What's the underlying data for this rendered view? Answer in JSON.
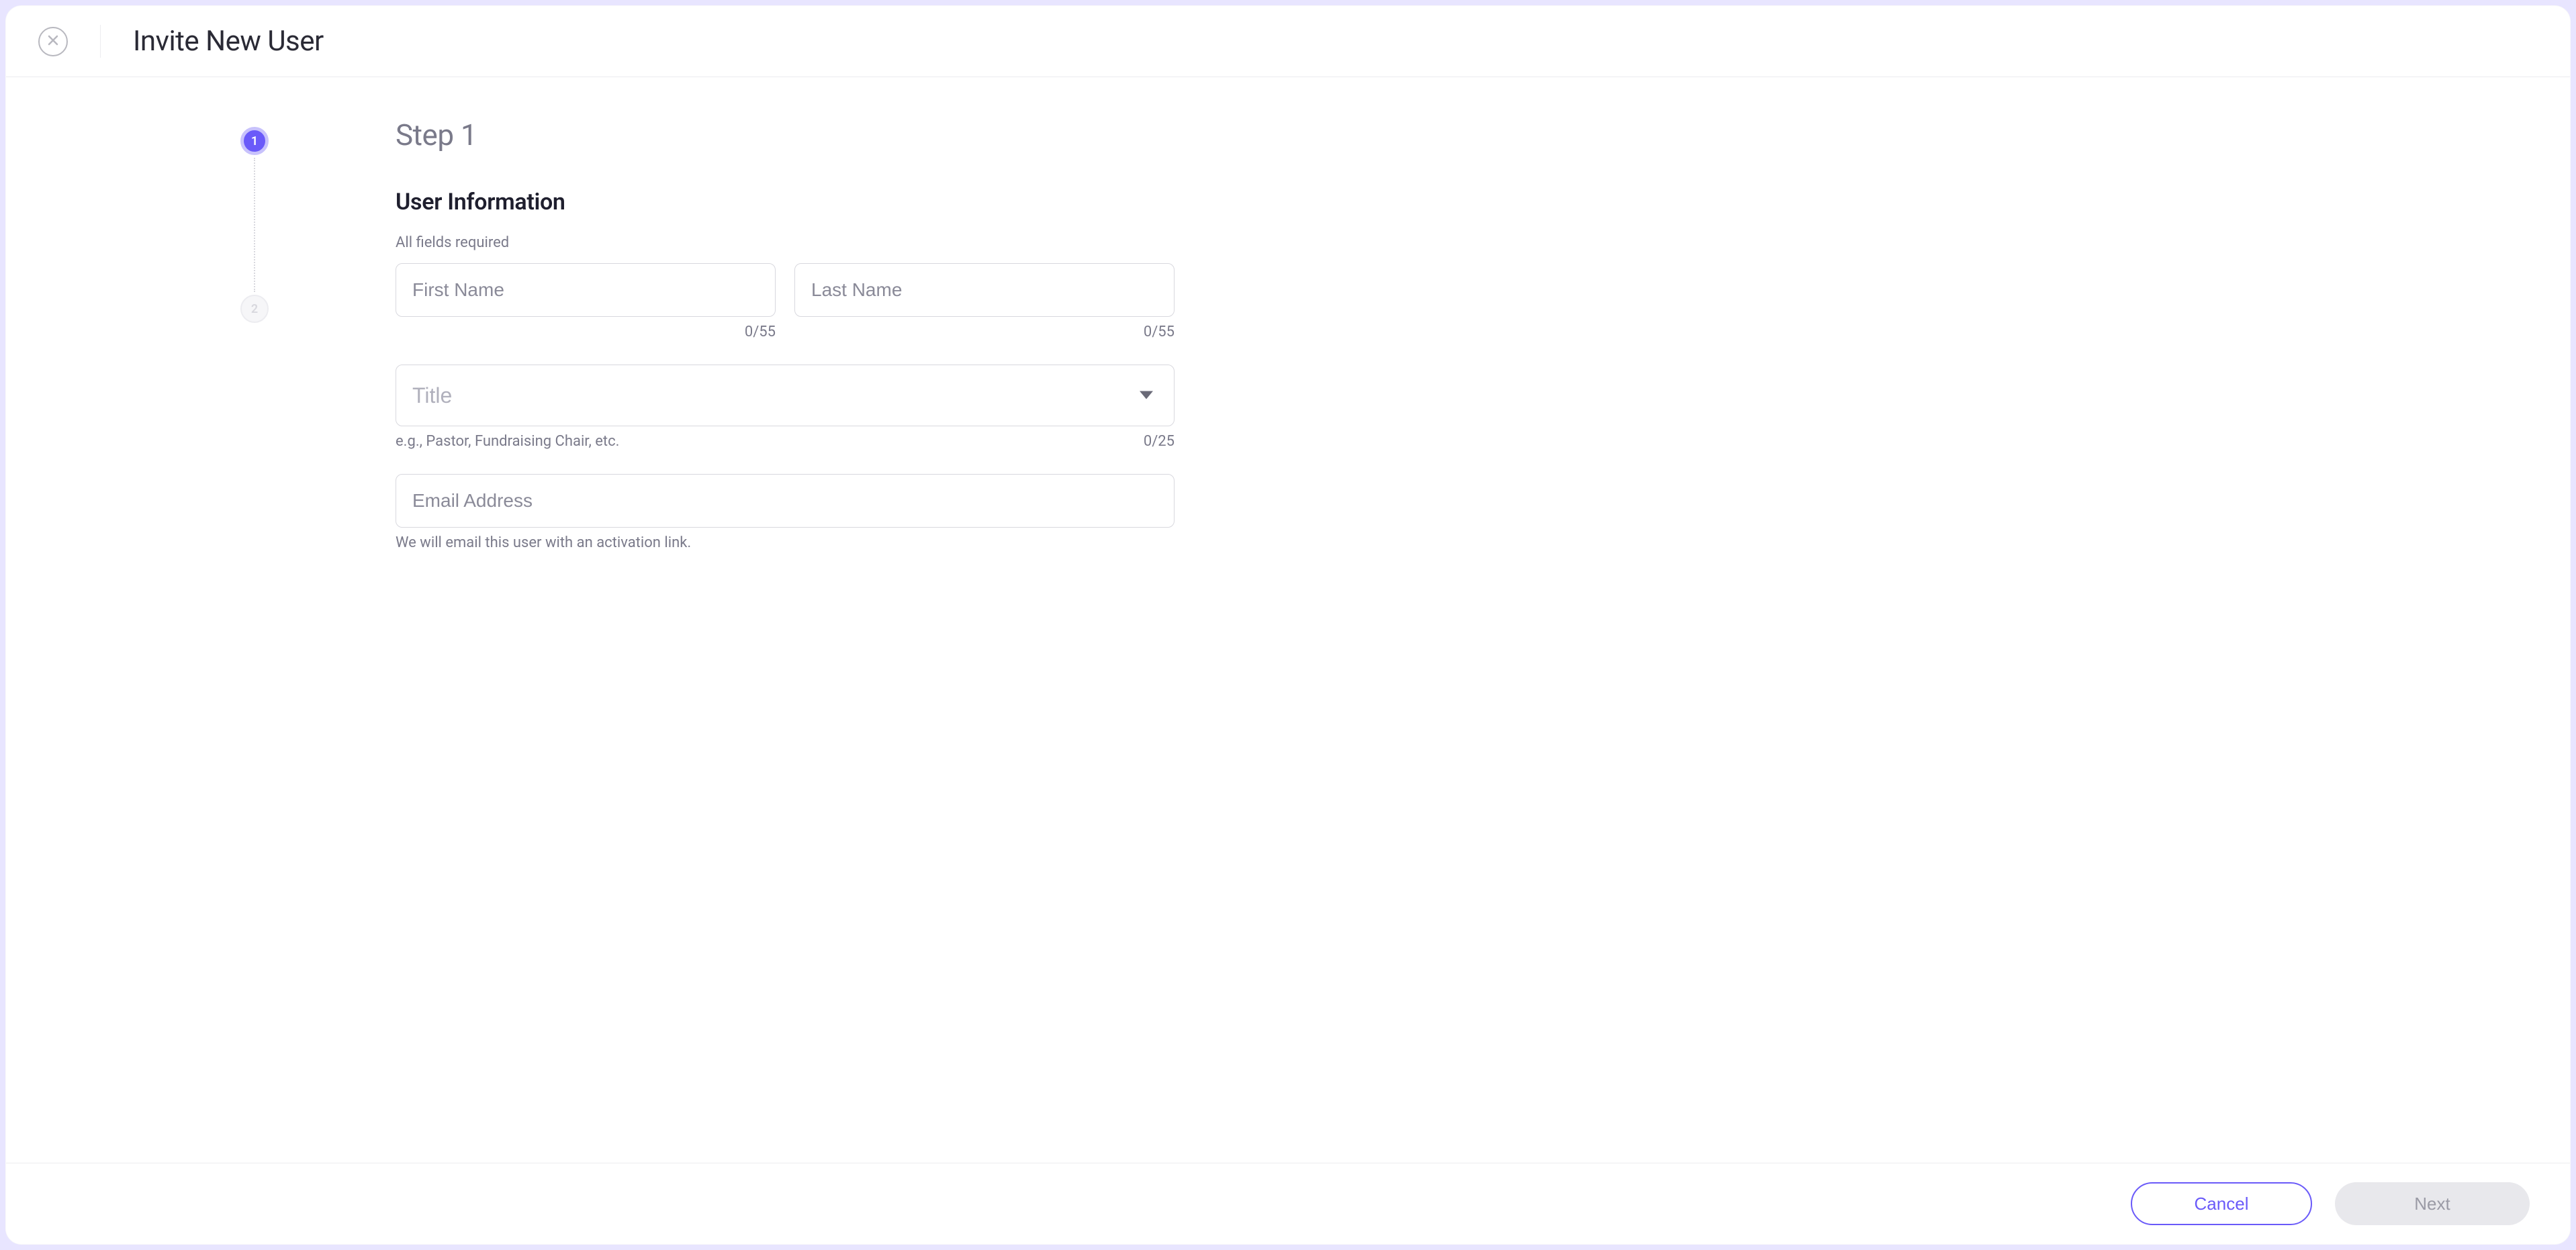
{
  "header": {
    "title": "Invite New User"
  },
  "stepper": {
    "step1": "1",
    "step2": "2"
  },
  "form": {
    "step_title": "Step 1",
    "section_title": "User Information",
    "required_note": "All fields required",
    "first_name": {
      "placeholder": "First Name",
      "counter": "0/55"
    },
    "last_name": {
      "placeholder": "Last Name",
      "counter": "0/55"
    },
    "title_field": {
      "placeholder": "Title",
      "helper": "e.g., Pastor, Fundraising Chair, etc.",
      "counter": "0/25"
    },
    "email": {
      "placeholder": "Email Address",
      "helper": "We will email this user with an activation link."
    }
  },
  "footer": {
    "cancel": "Cancel",
    "next": "Next"
  }
}
